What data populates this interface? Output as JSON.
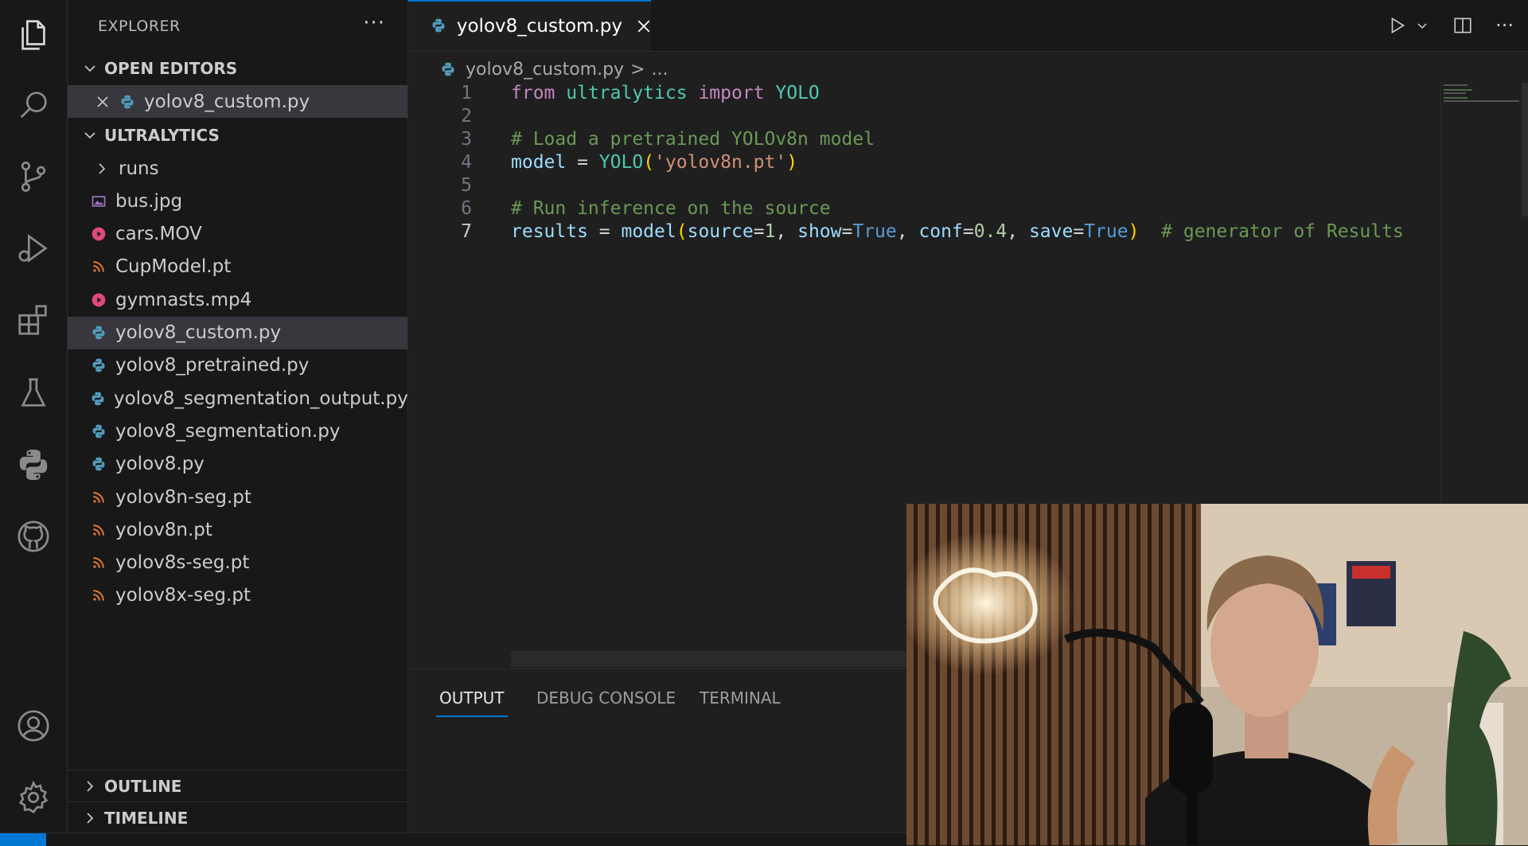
{
  "sidebar": {
    "title": "EXPLORER",
    "more": "···",
    "open_editors_label": "OPEN EDITORS",
    "open_editor_file": "yolov8_custom.py",
    "project_label": "ULTRALYTICS",
    "files": [
      {
        "name": "runs",
        "type": "folder"
      },
      {
        "name": "bus.jpg",
        "type": "image"
      },
      {
        "name": "cars.MOV",
        "type": "video"
      },
      {
        "name": "CupModel.pt",
        "type": "model"
      },
      {
        "name": "gymnasts.mp4",
        "type": "video"
      },
      {
        "name": "yolov8_custom.py",
        "type": "python"
      },
      {
        "name": "yolov8_pretrained.py",
        "type": "python"
      },
      {
        "name": "yolov8_segmentation_output.py",
        "type": "python"
      },
      {
        "name": "yolov8_segmentation.py",
        "type": "python"
      },
      {
        "name": "yolov8.py",
        "type": "python"
      },
      {
        "name": "yolov8n-seg.pt",
        "type": "model"
      },
      {
        "name": "yolov8n.pt",
        "type": "model"
      },
      {
        "name": "yolov8s-seg.pt",
        "type": "model"
      },
      {
        "name": "yolov8x-seg.pt",
        "type": "model"
      }
    ],
    "outline_label": "OUTLINE",
    "timeline_label": "TIMELINE"
  },
  "tab": {
    "label": "yolov8_custom.py"
  },
  "breadcrumb": {
    "file": "yolov8_custom.py",
    "separator": ">",
    "rest": "..."
  },
  "editor": {
    "line_numbers": [
      "1",
      "2",
      "3",
      "4",
      "5",
      "6",
      "7"
    ],
    "lines": {
      "l1": {
        "from": "from",
        "module": "ultralytics",
        "import": "import",
        "name": "YOLO"
      },
      "l3": {
        "comment": "# Load a pretrained YOLOv8n model"
      },
      "l4": {
        "var": "model",
        "eq": " = ",
        "call": "YOLO",
        "open": "(",
        "arg": "'yolov8n.pt'",
        "close": ")"
      },
      "l6": {
        "comment": "# Run inference on the source"
      },
      "l7": {
        "var": "results",
        "eq": " = ",
        "call": "model",
        "open": "(",
        "p1": "source",
        "v1": "1",
        "p2": "show",
        "v2": "True",
        "p3": "conf",
        "v3": "0.4",
        "p4": "save",
        "v4": "True",
        "close": ")",
        "comment": "# generator of Results"
      }
    }
  },
  "panel": {
    "tabs": [
      "OUTPUT",
      "DEBUG CONSOLE",
      "TERMINAL"
    ],
    "active": "OUTPUT"
  },
  "colors": {
    "accent": "#0078d4",
    "selection": "#37373d"
  }
}
